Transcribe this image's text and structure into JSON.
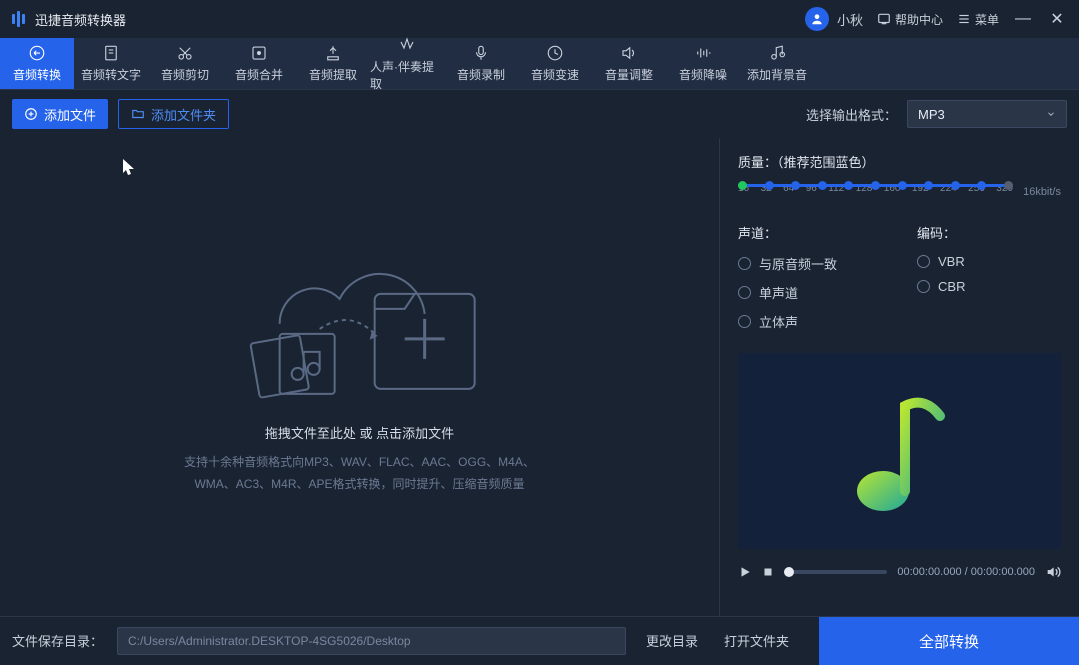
{
  "app": {
    "title": "迅捷音频转换器"
  },
  "titlebar": {
    "user_name": "小秋",
    "help_label": "帮助中心",
    "menu_label": "菜单"
  },
  "tools": [
    {
      "label": "音频转换",
      "icon": "convert"
    },
    {
      "label": "音频转文字",
      "icon": "to-text"
    },
    {
      "label": "音频剪切",
      "icon": "cut"
    },
    {
      "label": "音频合并",
      "icon": "merge"
    },
    {
      "label": "音频提取",
      "icon": "extract"
    },
    {
      "label": "人声·伴奏提取",
      "icon": "vocal"
    },
    {
      "label": "音频录制",
      "icon": "record"
    },
    {
      "label": "音频变速",
      "icon": "speed"
    },
    {
      "label": "音量调整",
      "icon": "volume"
    },
    {
      "label": "音频降噪",
      "icon": "denoise"
    },
    {
      "label": "添加背景音",
      "icon": "bgm"
    }
  ],
  "actions": {
    "add_file": "添加文件",
    "add_folder": "添加文件夹",
    "output_format_label": "选择输出格式：",
    "output_format_value": "MP3"
  },
  "dropzone": {
    "title": "拖拽文件至此处 或 点击添加文件",
    "sub1": "支持十余种音频格式向MP3、WAV、FLAC、AAC、OGG、M4A、",
    "sub2": "WMA、AC3、M4R、APE格式转换，同时提升、压缩音频质量"
  },
  "quality": {
    "label": "质量：（推荐范围蓝色）",
    "ticks": [
      "16",
      "32",
      "64",
      "96",
      "112",
      "128",
      "160",
      "192",
      "224",
      "256",
      "320"
    ],
    "unit": "16kbit/s"
  },
  "channels": {
    "header": "声道：",
    "options": [
      "与原音频一致",
      "单声道",
      "立体声"
    ]
  },
  "encoding": {
    "header": "编码：",
    "options": [
      "VBR",
      "CBR"
    ]
  },
  "player": {
    "time_current": "00:00:00.000",
    "time_total": "00:00:00.000"
  },
  "footer": {
    "label": "文件保存目录：",
    "path": "C:/Users/Administrator.DESKTOP-4SG5026/Desktop",
    "change_dir": "更改目录",
    "open_folder": "打开文件夹",
    "convert_all": "全部转换"
  }
}
